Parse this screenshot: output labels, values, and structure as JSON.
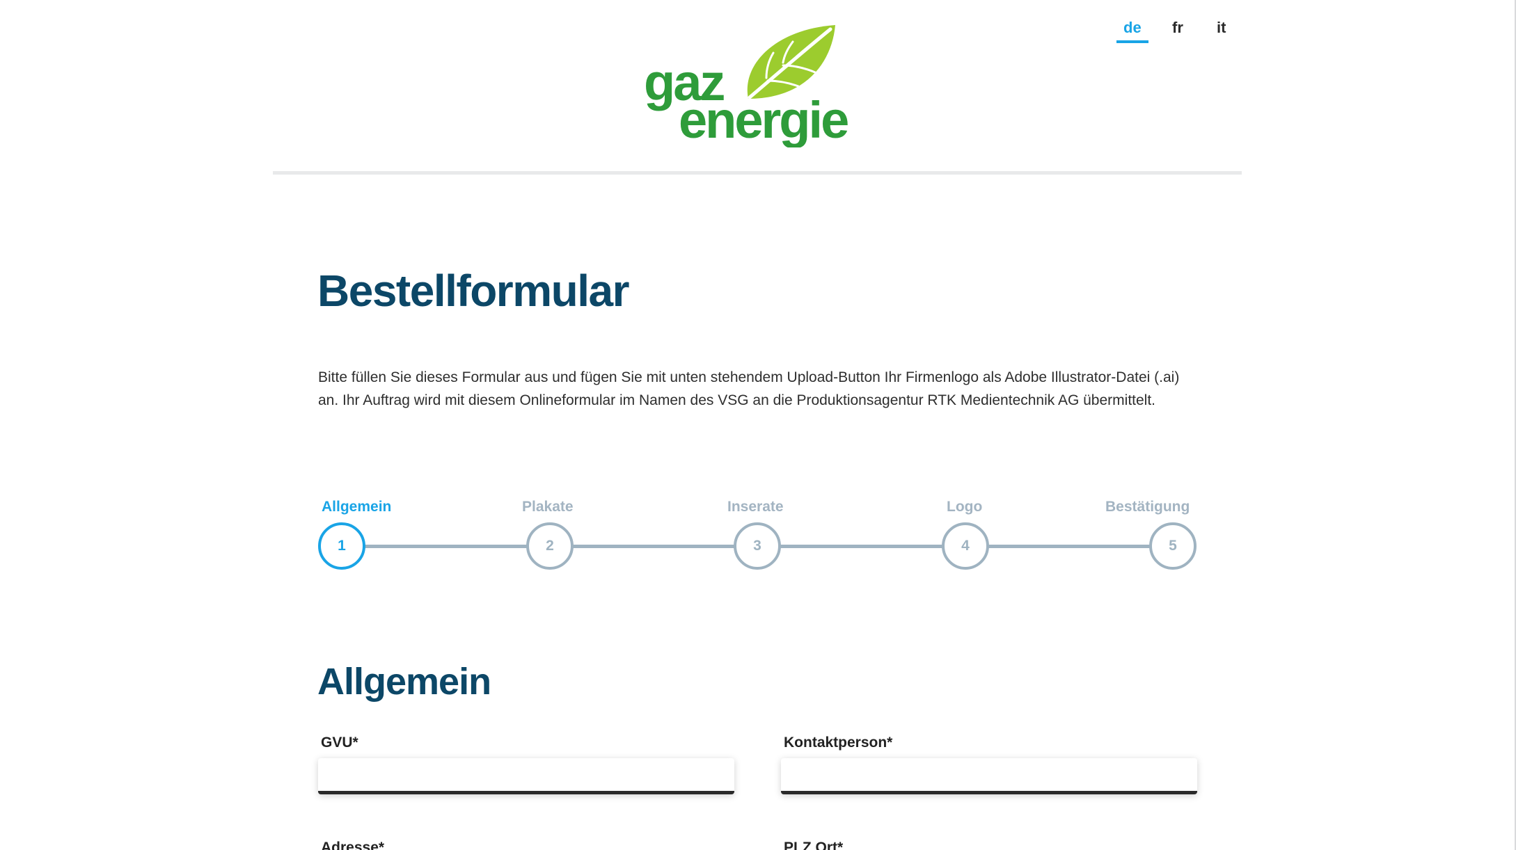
{
  "brand": {
    "logo_line1": "gaz",
    "logo_line2": "energie",
    "green": "#2e9c3a",
    "leaf_green": "#9ccc2e"
  },
  "colors": {
    "accent": "#19a4e6",
    "heading": "#0c4767",
    "step_inactive": "#9fb3c1"
  },
  "language_nav": [
    {
      "label": "de",
      "active": true
    },
    {
      "label": "fr",
      "active": false
    },
    {
      "label": "it",
      "active": false
    }
  ],
  "page": {
    "title": "Bestellformular",
    "intro_line1": "Bitte füllen Sie dieses Formular aus und fügen Sie mit unten stehendem Upload-Button Ihr Firmenlogo als Adobe Illustrator-Datei (.ai)",
    "intro_line2": "an. Ihr Auftrag wird mit diesem Onlineformular im Namen des VSG an die Produktionsagentur RTK Medientechnik AG übermittelt."
  },
  "stepper": {
    "current": 1,
    "steps": [
      {
        "label": "Allgemein",
        "number": "1"
      },
      {
        "label": "Plakate",
        "number": "2"
      },
      {
        "label": "Inserate",
        "number": "3"
      },
      {
        "label": "Logo",
        "number": "4"
      },
      {
        "label": "Bestätigung",
        "number": "5"
      }
    ]
  },
  "section": {
    "title": "Allgemein",
    "fields": {
      "gvu": {
        "label": "GVU*",
        "value": ""
      },
      "kontaktperson": {
        "label": "Kontaktperson*",
        "value": ""
      },
      "adresse": {
        "label": "Adresse*",
        "value": ""
      },
      "plz_ort": {
        "label": "PLZ Ort*",
        "value": ""
      }
    }
  }
}
